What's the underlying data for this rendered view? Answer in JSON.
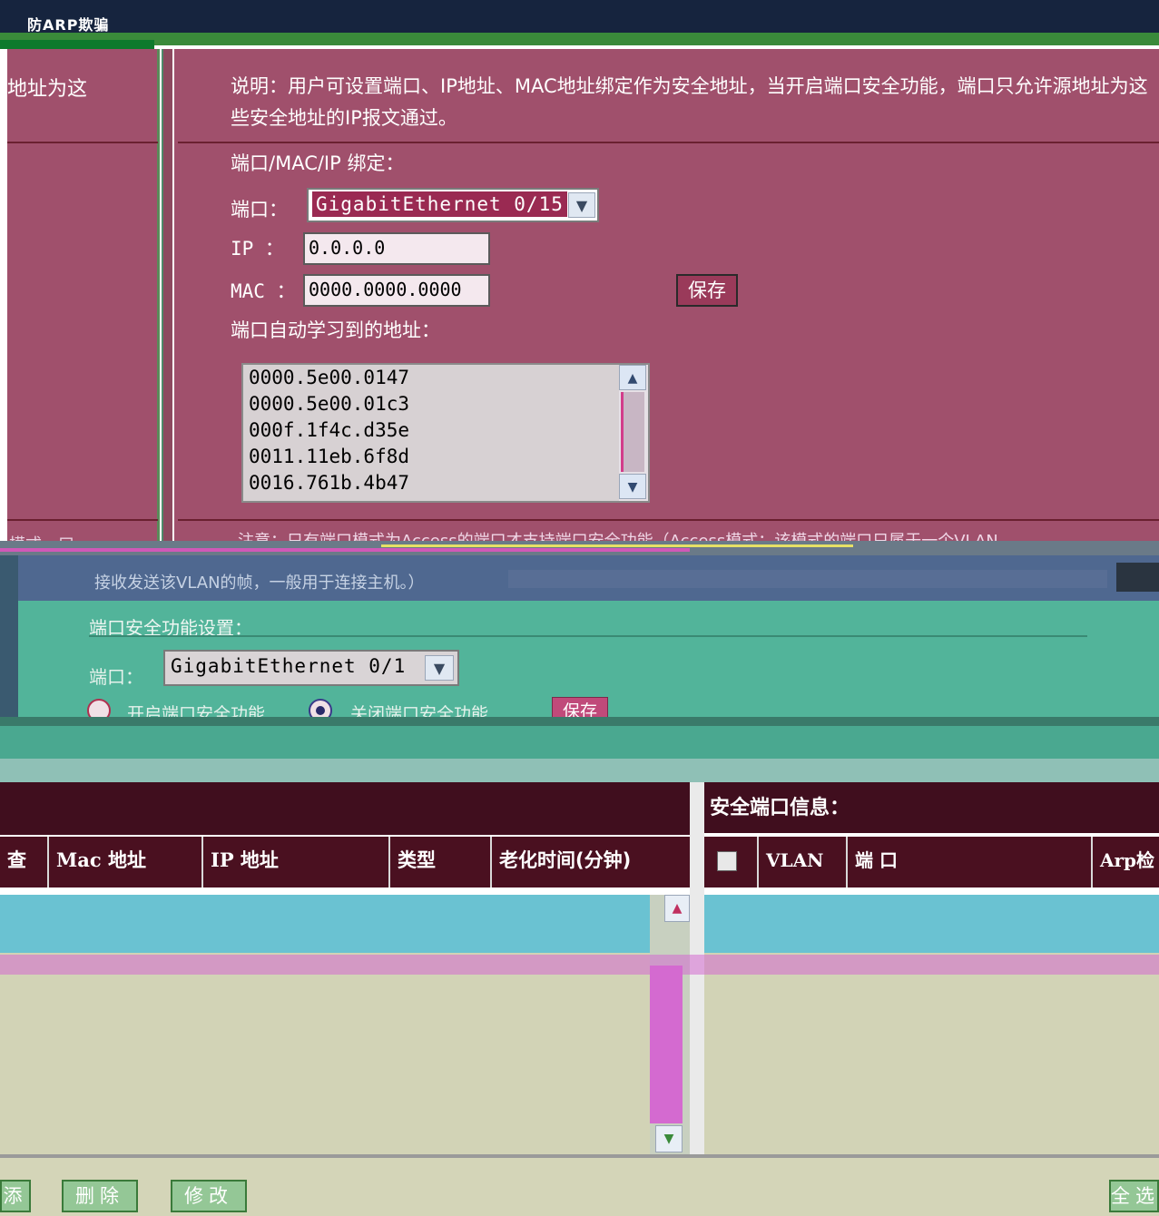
{
  "header": {
    "title": "防ARP欺骗"
  },
  "left_panel": {
    "desc": "地址为这",
    "footer": "模式…口"
  },
  "binding": {
    "desc": "说明：用户可设置端口、IP地址、MAC地址绑定作为安全地址，当开启端口安全功能，端口只允许源地址为这些安全地址的IP报文通过。",
    "section_title": "端口/MAC/IP 绑定：",
    "port_label": "端口：",
    "port_value": "GigabitEthernet 0/15",
    "ip_label": "IP  ：",
    "ip_value": "0.0.0.0",
    "mac_label": "MAC ：",
    "mac_value": "0000.0000.0000",
    "save_label": "保存",
    "learned_title": "端口自动学习到的地址：",
    "learned": [
      "0000.5e00.0147",
      "0000.5e00.01c3",
      "000f.1f4c.d35e",
      "0011.11eb.6f8d",
      "0016.761b.4b47"
    ],
    "note": "注意：只有端口模式为Access的端口才支持端口安全功能（Access模式：该模式的端口只属于一个VLAN，"
  },
  "blue_band": {
    "text": "接收发送该VLAN的帧，一般用于连接主机。）"
  },
  "port_security": {
    "title": "端口安全功能设置：",
    "port_label": "端口：",
    "port_value": "GigabitEthernet 0/1",
    "enable_label": "开启端口安全功能",
    "disable_label": "关闭端口安全功能",
    "save_label": "保存"
  },
  "address_table": {
    "columns": [
      "查",
      "Mac 地址",
      "IP 地址",
      "类型",
      "老化时间(分钟)"
    ],
    "rows": []
  },
  "secure_ports": {
    "title": "安全端口信息：",
    "columns": [
      "VLAN",
      "端 口",
      "Arp检"
    ],
    "rows": []
  },
  "actions": {
    "add": "添",
    "delete": "删除",
    "modify": "修改",
    "select_all": "全选"
  }
}
